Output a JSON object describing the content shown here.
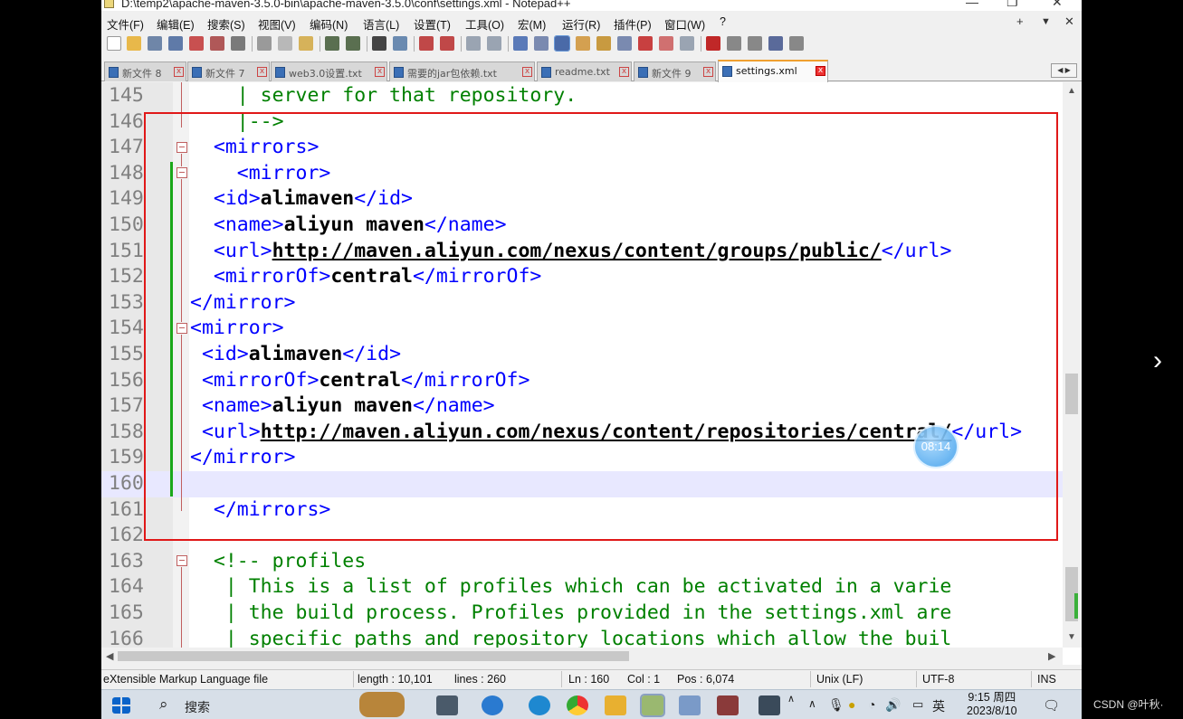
{
  "window": {
    "title": "D:\\temp2\\apache-maven-3.5.0-bin\\apache-maven-3.5.0\\conf\\settings.xml - Notepad++"
  },
  "menu": [
    "文件(F)",
    "编辑(E)",
    "搜索(S)",
    "视图(V)",
    "编码(N)",
    "语言(L)",
    "设置(T)",
    "工具(O)",
    "宏(M)",
    "运行(R)",
    "插件(P)",
    "窗口(W)",
    "?"
  ],
  "menu_right": {
    "plus": "+",
    "dropdown": "▼",
    "close": "✕"
  },
  "tabs": [
    {
      "label": "新文件 8"
    },
    {
      "label": "新文件 7"
    },
    {
      "label": "web3.0设置.txt"
    },
    {
      "label": "需要的jar包依赖.txt"
    },
    {
      "label": "readme.txt"
    },
    {
      "label": "新文件 9"
    },
    {
      "label": "settings.xml",
      "active": true
    }
  ],
  "editor": {
    "lines": [
      {
        "num": "145",
        "html": "<span class=\"cm\">    | server for that repository.</span>"
      },
      {
        "num": "146",
        "html": "<span class=\"cm\">    |--&gt;</span>"
      },
      {
        "num": "147",
        "html": "  <span class=\"tg\">&lt;mirrors&gt;</span>"
      },
      {
        "num": "148",
        "html": "    <span class=\"tg\">&lt;mirror&gt;</span>"
      },
      {
        "num": "149",
        "html": "  <span class=\"tg\">&lt;id&gt;</span><span class=\"bd\">alimaven</span><span class=\"tg\">&lt;/id&gt;</span>"
      },
      {
        "num": "150",
        "html": "  <span class=\"tg\">&lt;name&gt;</span><span class=\"bd\">aliyun maven</span><span class=\"tg\">&lt;/name&gt;</span>"
      },
      {
        "num": "151",
        "html": "  <span class=\"tg\">&lt;url&gt;</span><span class=\"lk\">http://maven.aliyun.com/nexus/content/groups/public/</span><span class=\"tg\">&lt;/url&gt;</span>"
      },
      {
        "num": "152",
        "html": "  <span class=\"tg\">&lt;mirrorOf&gt;</span><span class=\"bd\">central</span><span class=\"tg\">&lt;/mirrorOf&gt;</span>"
      },
      {
        "num": "153",
        "html": "<span class=\"tg\">&lt;/mirror&gt;</span>"
      },
      {
        "num": "154",
        "html": "<span class=\"tg\">&lt;mirror&gt;</span>"
      },
      {
        "num": "155",
        "html": " <span class=\"tg\">&lt;id&gt;</span><span class=\"bd\">alimaven</span><span class=\"tg\">&lt;/id&gt;</span>"
      },
      {
        "num": "156",
        "html": " <span class=\"tg\">&lt;mirrorOf&gt;</span><span class=\"bd\">central</span><span class=\"tg\">&lt;/mirrorOf&gt;</span>"
      },
      {
        "num": "157",
        "html": " <span class=\"tg\">&lt;name&gt;</span><span class=\"bd\">aliyun maven</span><span class=\"tg\">&lt;/name&gt;</span>"
      },
      {
        "num": "158",
        "html": " <span class=\"tg\">&lt;url&gt;</span><span class=\"lk\">http://maven.aliyun.com/nexus/content/repositories/central/</span><span class=\"tg\">&lt;/url&gt;</span>"
      },
      {
        "num": "159",
        "html": "<span class=\"tg\">&lt;/mirror&gt;</span>"
      },
      {
        "num": "160",
        "html": "",
        "current": true
      },
      {
        "num": "161",
        "html": "  <span class=\"tg\">&lt;/mirrors&gt;</span>"
      },
      {
        "num": "162",
        "html": ""
      },
      {
        "num": "163",
        "html": "  <span class=\"cm\">&lt;!-- profiles</span>"
      },
      {
        "num": "164",
        "html": "<span class=\"cm\">   | This is a list of profiles which can be activated in a varie</span>"
      },
      {
        "num": "165",
        "html": "<span class=\"cm\">   | the build process. Profiles provided in the settings.xml are</span>"
      },
      {
        "num": "166",
        "html": "<span class=\"cm\">   | specific paths and repository locations which allow the buil</span>"
      }
    ]
  },
  "video_badge": "08:14",
  "statusbar": {
    "filetype": "eXtensible Markup Language file",
    "length": "length : 10,101",
    "lines": "lines : 260",
    "ln": "Ln : 160",
    "col": "Col : 1",
    "pos": "Pos : 6,074",
    "eol": "Unix (LF)",
    "encoding": "UTF-8",
    "mode": "INS"
  },
  "taskbar": {
    "search_label": "搜索",
    "ime": "英",
    "time": "9:15 周四",
    "date": "2023/8/10"
  },
  "watermark": "CSDN @叶秋·"
}
